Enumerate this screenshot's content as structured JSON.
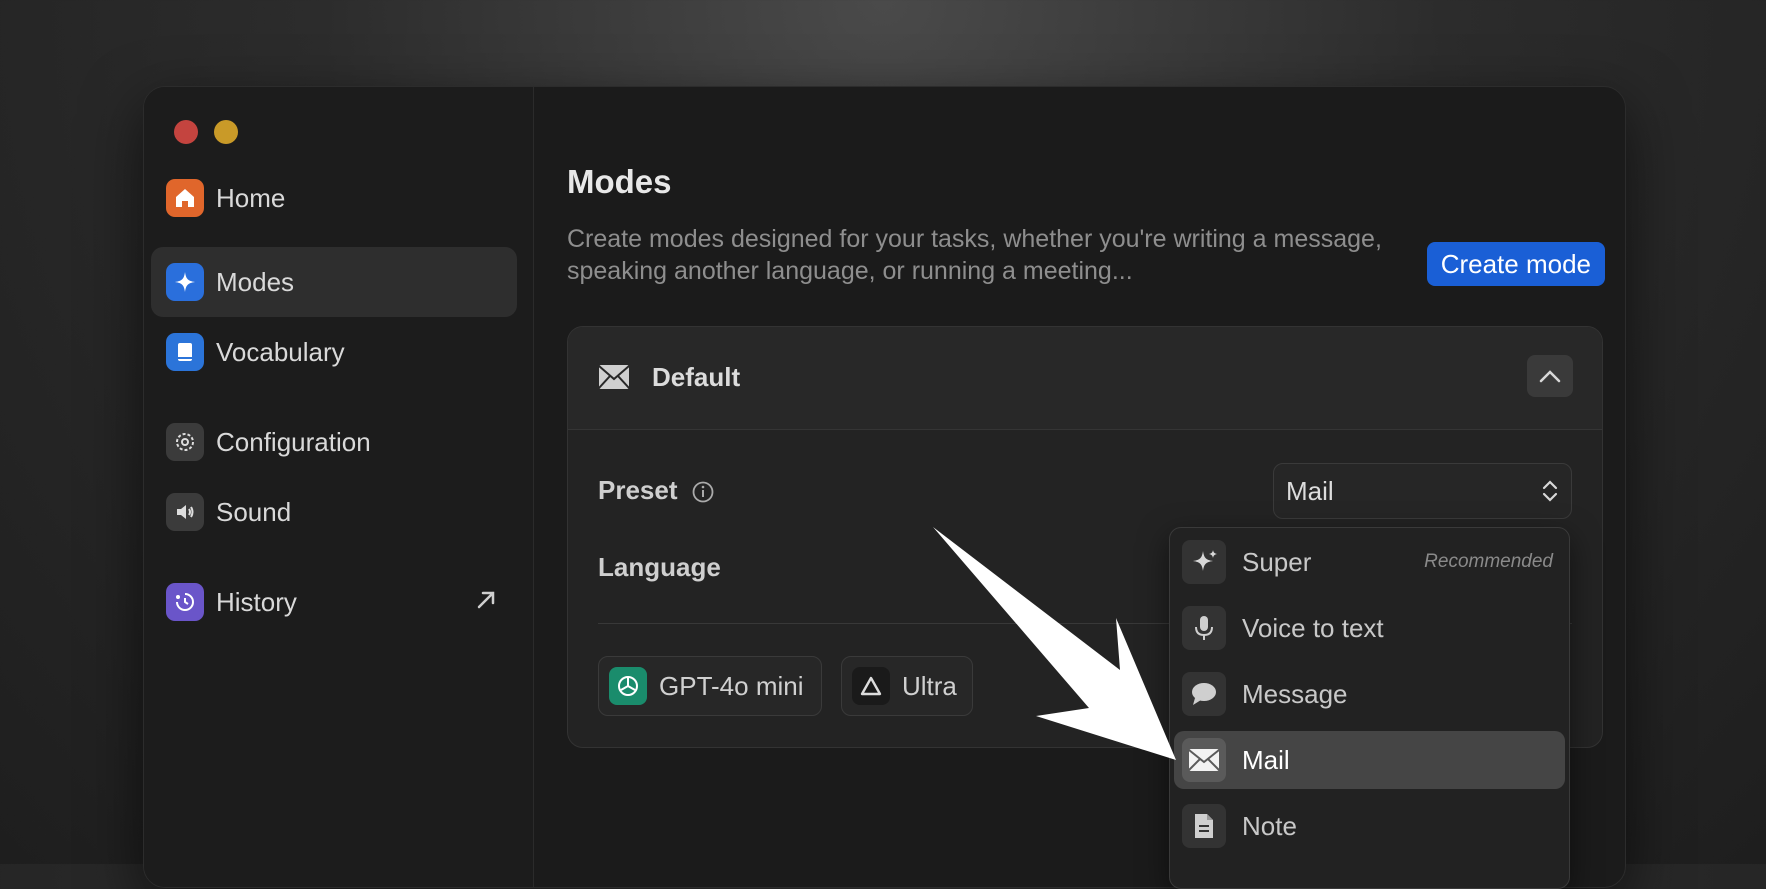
{
  "sidebar": {
    "items": [
      {
        "label": "Home",
        "icon": "home-icon"
      },
      {
        "label": "Modes",
        "icon": "sparkle-icon",
        "active": true
      },
      {
        "label": "Vocabulary",
        "icon": "book-icon"
      },
      {
        "label": "Configuration",
        "icon": "gear-icon"
      },
      {
        "label": "Sound",
        "icon": "speaker-icon"
      },
      {
        "label": "History",
        "icon": "history-icon",
        "external": true
      }
    ]
  },
  "main": {
    "title": "Modes",
    "description": "Create modes designed for your tasks, whether you're writing a message, speaking another language, or running a meeting...",
    "create_button": "Create mode",
    "card": {
      "title": "Default",
      "preset_label": "Preset",
      "preset_value": "Mail",
      "language_label": "Language",
      "chips": [
        {
          "label": "GPT-4o mini",
          "icon": "openai-icon"
        },
        {
          "label": "Ultra",
          "icon": "triangle-icon"
        }
      ]
    }
  },
  "dropdown": {
    "items": [
      {
        "label": "Super",
        "badge": "Recommended",
        "icon": "sparkle-icon"
      },
      {
        "label": "Voice to text",
        "icon": "microphone-icon"
      },
      {
        "label": "Message",
        "icon": "speech-bubble-icon"
      },
      {
        "label": "Mail",
        "icon": "envelope-icon",
        "selected": true
      },
      {
        "label": "Note",
        "icon": "document-icon"
      }
    ]
  },
  "colors": {
    "accent": "#1a5fd6",
    "home_icon": "#e0662b",
    "modes_icon": "#2a6fdc",
    "vocabulary_icon": "#2b74d9",
    "history_icon": "#6a55c9",
    "openai_icon": "#1a8c6c"
  }
}
